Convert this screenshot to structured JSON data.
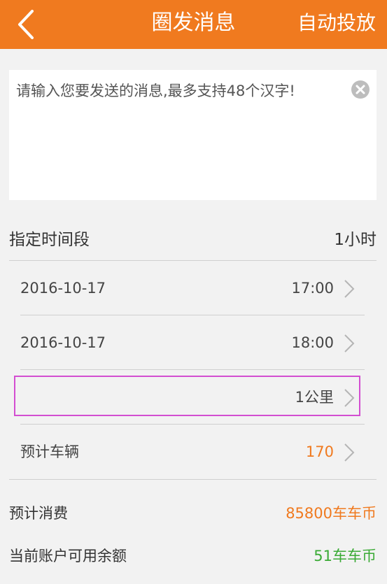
{
  "header": {
    "title": "圈发消息",
    "action_label": "自动投放"
  },
  "message": {
    "placeholder": "请输入您要发送的消息,最多支持48个汉字!",
    "value": ""
  },
  "time_section": {
    "label": "指定时间段",
    "duration": "1小时"
  },
  "items": [
    {
      "label": "2016-10-17",
      "value": "17:00"
    },
    {
      "label": "2016-10-17",
      "value": "18:00"
    },
    {
      "label": "",
      "value": "1公里"
    },
    {
      "label": "预计车辆",
      "value": "170"
    }
  ],
  "summary": {
    "cost_label": "预计消费",
    "cost_value": "85800车车币",
    "balance_label": "当前账户可用余额",
    "balance_value": "51车车币"
  },
  "colors": {
    "accent": "#f07a1f",
    "highlight": "#d34ed1",
    "balance": "#3aaa35"
  }
}
